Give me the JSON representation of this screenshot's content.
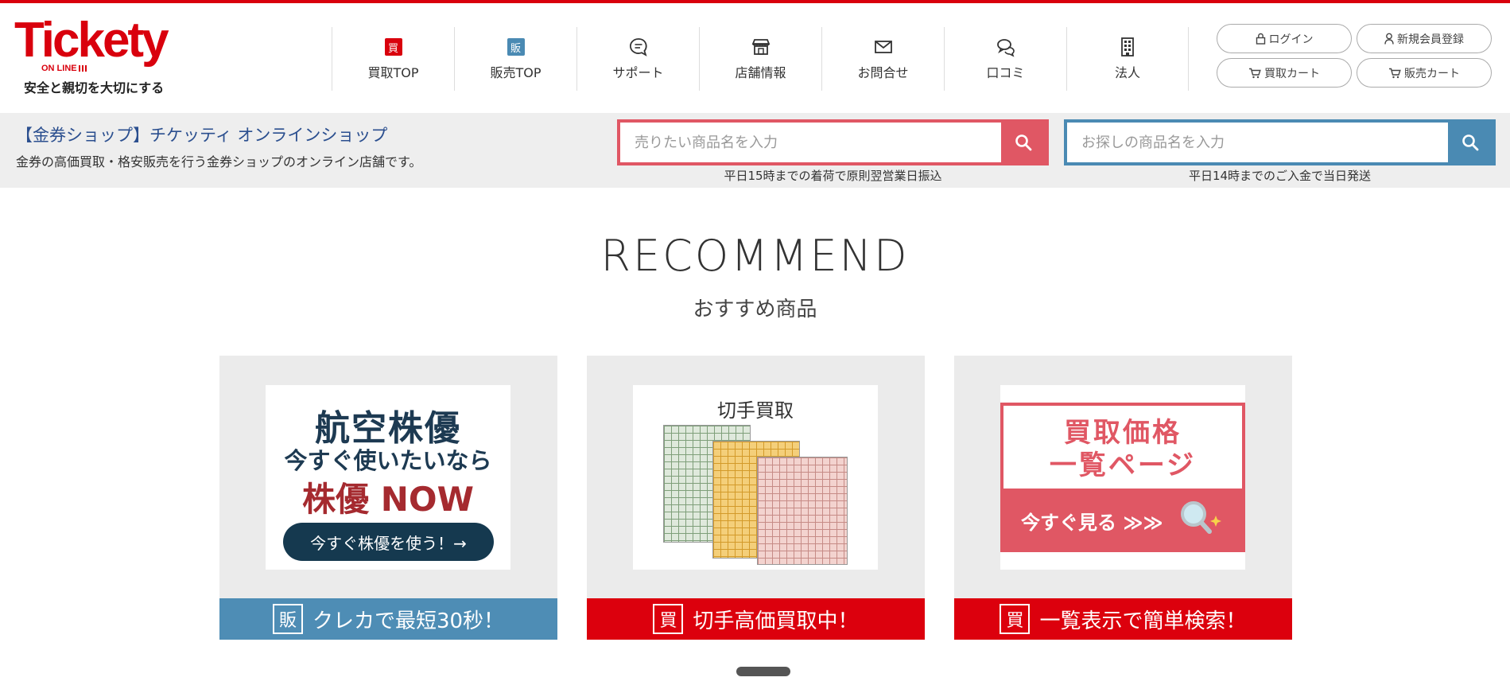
{
  "brand": {
    "logo_text": "Tickety",
    "logo_sub": "ON LINE",
    "tagline": "安全と親切を大切にする",
    "accent_red": "#d9000d",
    "accent_blue": "#4a8ab3",
    "accent_pink": "#e05764"
  },
  "nav": [
    {
      "label": "買取TOP",
      "icon": "buy-badge-icon",
      "badge": "買"
    },
    {
      "label": "販売TOP",
      "icon": "sell-badge-icon",
      "badge": "販"
    },
    {
      "label": "サポート",
      "icon": "chat-bubble-icon"
    },
    {
      "label": "店舗情報",
      "icon": "store-icon"
    },
    {
      "label": "お問合せ",
      "icon": "mail-icon"
    },
    {
      "label": "口コミ",
      "icon": "comments-icon"
    },
    {
      "label": "法人",
      "icon": "building-icon"
    }
  ],
  "account": {
    "login": "ログイン",
    "register": "新規会員登録",
    "buy_cart": "買取カート",
    "sell_cart": "販売カート"
  },
  "band": {
    "title": "【金券ショップ】チケッティ オンラインショップ",
    "desc": "金券の高価買取・格安販売を行う金券ショップのオンライン店舗です。",
    "sell_search": {
      "placeholder": "売りたい商品名を入力",
      "note": "平日15時までの着荷で原則翌営業日振込"
    },
    "buy_search": {
      "placeholder": "お探しの商品名を入力",
      "note": "平日14時までのご入金で当日発送"
    }
  },
  "recommend": {
    "title": "RECOMMEND",
    "subtitle": "おすすめ商品",
    "cards": [
      {
        "badge": "販",
        "caption": "クレカで最短30秒！",
        "img": {
          "line1": "航空株優",
          "line2": "今すぐ使いたいなら",
          "line3": "株優 NOW",
          "button": "今すぐ株優を使う！→"
        }
      },
      {
        "badge": "買",
        "caption": "切手高価買取中！",
        "img": {
          "line1": "切手買取"
        }
      },
      {
        "badge": "買",
        "caption": "一覧表示で簡単検索！",
        "img": {
          "line1": "買取価格",
          "line2": "一覧ページ",
          "line3": "今すぐ見る ≫≫"
        }
      }
    ]
  }
}
